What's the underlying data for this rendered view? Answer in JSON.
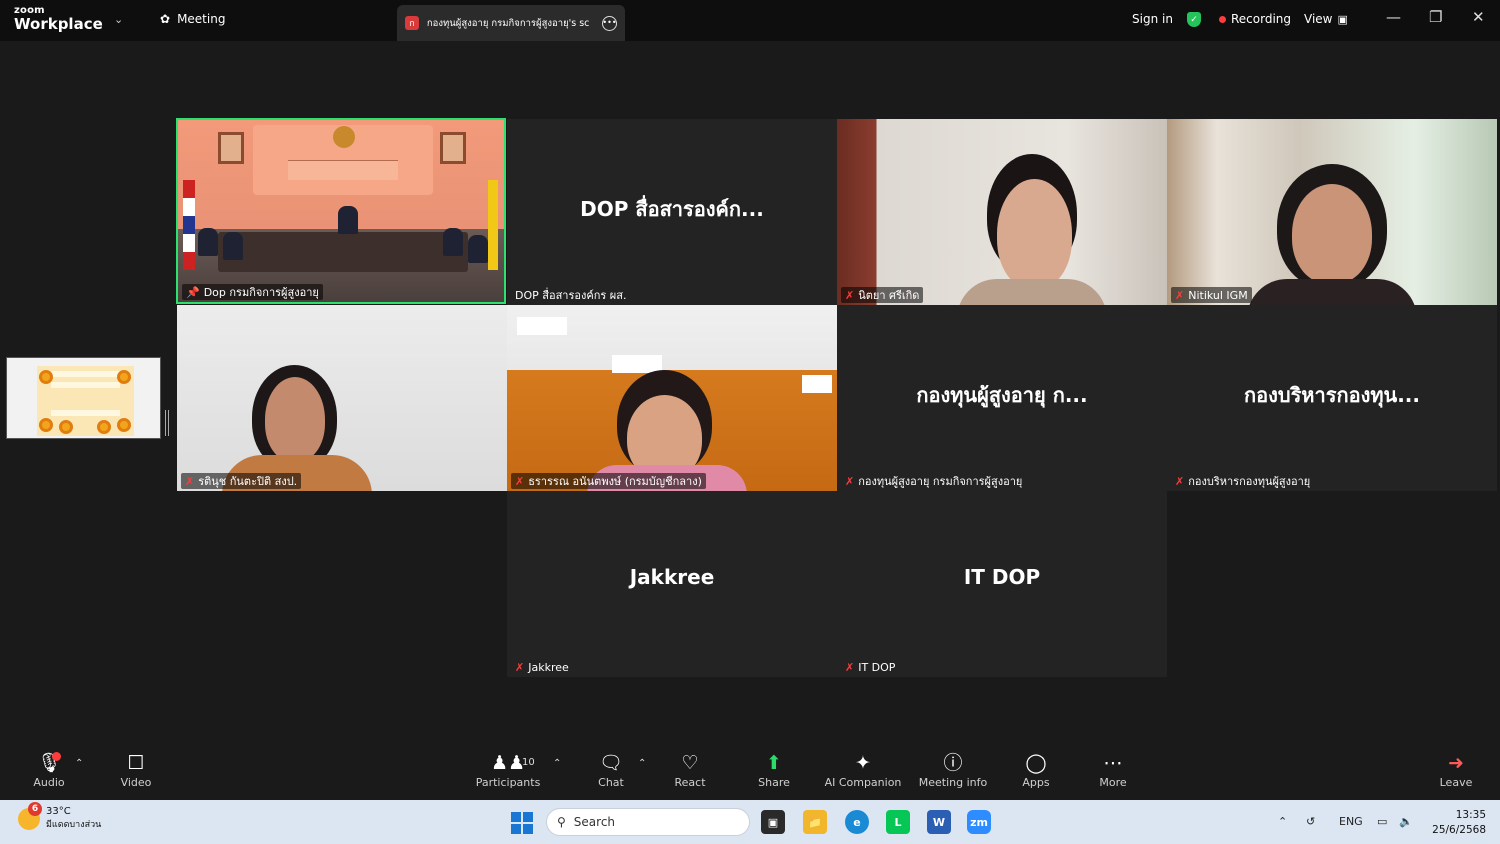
{
  "titlebar": {
    "brand_top": "zoom",
    "brand_bottom": "Workplace",
    "meeting_tab": "Meeting",
    "share_tab": "กองทุนผู้สูงอายุ กรมกิจการผู้สูงอายุ's sc",
    "sign_in": "Sign in",
    "recording": "Recording",
    "view": "View"
  },
  "tiles": [
    {
      "big": "",
      "label": "Dop กรมกิจการผู้สูงอายุ",
      "state": "pinned-active"
    },
    {
      "big": "DOP สื่อสารองค์ก...",
      "label": "DOP สื่อสารองค์กร ผส.",
      "state": "no-video"
    },
    {
      "big": "",
      "label": "นิตยา ศรีเกิด",
      "state": "muted-video"
    },
    {
      "big": "",
      "label": "Nitikul IGM",
      "state": "muted-video"
    },
    {
      "big": "",
      "label": "รตินุช กันตะปิติ สงป.",
      "state": "muted-video"
    },
    {
      "big": "",
      "label": "ธรารรณ อนันตพงษ์ (กรมบัญชีกลาง)",
      "state": "muted-video"
    },
    {
      "big": "กองทุนผู้สูงอายุ ก...",
      "label": "กองทุนผู้สูงอายุ กรมกิจการผู้สูงอายุ",
      "state": "muted-no-video"
    },
    {
      "big": "กองบริหารกองทุน...",
      "label": "กองบริหารกองทุนผู้สูงอายุ",
      "state": "muted-no-video"
    },
    {
      "big": "Jakkree",
      "label": "Jakkree",
      "state": "muted-no-video"
    },
    {
      "big": "IT DOP",
      "label": "IT DOP",
      "state": "muted-no-video"
    }
  ],
  "toolbar": {
    "audio": "Audio",
    "video": "Video",
    "participants": "Participants",
    "participants_count": "10",
    "chat": "Chat",
    "react": "React",
    "share": "Share",
    "ai_companion": "AI Companion",
    "meeting_info": "Meeting info",
    "apps": "Apps",
    "more": "More",
    "leave": "Leave"
  },
  "taskbar": {
    "weather_badge": "6",
    "temperature": "33°C",
    "weather_desc": "มีแดดบางส่วน",
    "search_placeholder": "Search",
    "language": "ENG",
    "time": "13:35",
    "date": "25/6/2568"
  },
  "colors": {
    "active_speaker": "#2ee06d",
    "muted": "#ff3b3b",
    "share_green": "#2fd96a"
  }
}
